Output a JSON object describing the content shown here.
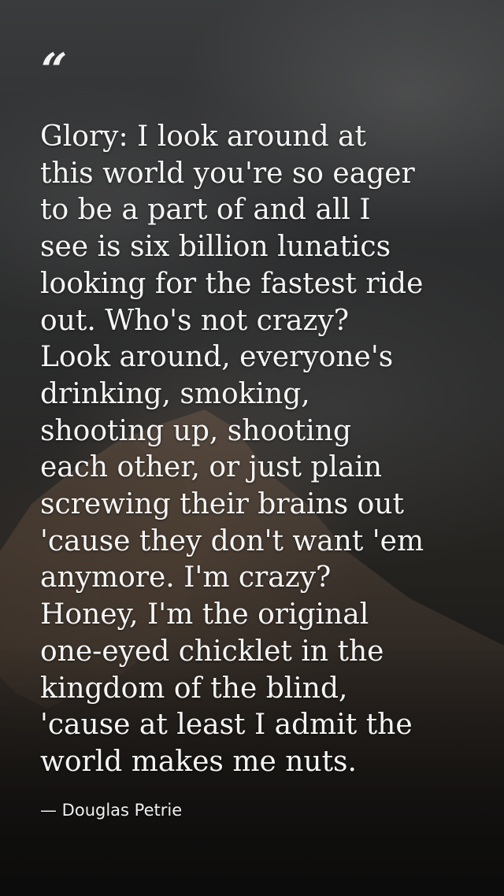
{
  "quote": {
    "mark": "“",
    "lines": [
      "Glory: I look around at",
      "this world you're so eager",
      "to be a part of and all I",
      "see is six billion lunatics",
      "looking for the fastest ride",
      "out. Who's not crazy?",
      "Look around, everyone's",
      "drinking, smoking,",
      "shooting up, shooting",
      "each other, or just plain",
      "screwing their brains out",
      "'cause they don't want 'em",
      "anymore. I'm crazy?",
      "Honey, I'm the original",
      "one-eyed chicklet in the",
      "kingdom of the blind,",
      "'cause at least I admit the",
      "world makes me nuts."
    ],
    "author": "— Douglas Petrie"
  },
  "colors": {
    "text": "#f5f5f5",
    "background_top": "#3a3b3c",
    "background_bottom": "#0e0e0e",
    "mountain_tint": "#5a4a3c"
  }
}
